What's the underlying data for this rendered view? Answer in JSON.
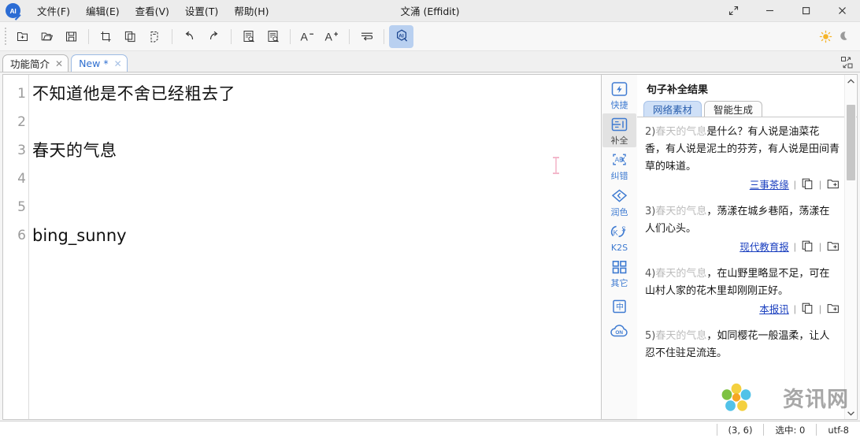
{
  "window": {
    "title": "文涌 (Effidit)",
    "logo_text": "AI",
    "controls": {
      "fullscreen": "fullscreen-icon",
      "minimize": "minimize-icon",
      "maximize": "maximize-icon",
      "close": "close-icon"
    }
  },
  "menubar": {
    "items": [
      {
        "label": "文件(F)",
        "name": "menu-file"
      },
      {
        "label": "编辑(E)",
        "name": "menu-edit"
      },
      {
        "label": "查看(V)",
        "name": "menu-view"
      },
      {
        "label": "设置(T)",
        "name": "menu-settings"
      },
      {
        "label": "帮助(H)",
        "name": "menu-help"
      }
    ]
  },
  "toolbar": {
    "buttons": [
      {
        "icon": "new-file-icon",
        "name": "new-file-button"
      },
      {
        "icon": "open-folder-icon",
        "name": "open-file-button"
      },
      {
        "icon": "save-icon",
        "name": "save-button"
      },
      {
        "icon": "cut-icon",
        "name": "cut-button"
      },
      {
        "icon": "copy-icon",
        "name": "copy-button"
      },
      {
        "icon": "paste-icon",
        "name": "paste-button"
      },
      {
        "icon": "undo-icon",
        "name": "undo-button"
      },
      {
        "icon": "redo-icon",
        "name": "redo-button"
      },
      {
        "icon": "find-icon",
        "name": "find-button"
      },
      {
        "icon": "replace-icon",
        "name": "replace-button"
      },
      {
        "icon": "font-decrease-icon",
        "name": "font-decrease-button"
      },
      {
        "icon": "font-increase-icon",
        "name": "font-increase-button"
      },
      {
        "icon": "wrap-text-icon",
        "name": "wrap-text-button"
      },
      {
        "icon": "ai-assistant-icon",
        "name": "ai-assistant-button"
      }
    ],
    "theme": {
      "light_icon": "sun-icon",
      "dark_icon": "moon-icon"
    }
  },
  "tabs": {
    "items": [
      {
        "label": "功能简介",
        "active": false,
        "closable": true
      },
      {
        "label": "New *",
        "active": true,
        "closable": true
      }
    ],
    "split_view_icon": "split-layout-icon"
  },
  "editor": {
    "lines": [
      {
        "no": "1",
        "text": "不知道他是不舍已经粗去了",
        "script": "cjk"
      },
      {
        "no": "2",
        "text": "",
        "script": "cjk"
      },
      {
        "no": "3",
        "text": "春天的气息",
        "script": "cjk"
      },
      {
        "no": "4",
        "text": "",
        "script": "cjk"
      },
      {
        "no": "5",
        "text": "",
        "script": "cjk"
      },
      {
        "no": "6",
        "text": "bing_sunny",
        "script": "latin"
      }
    ]
  },
  "rail": {
    "items": [
      {
        "label": "快捷",
        "icon": "lightning-icon",
        "active": false,
        "name": "rail-item-shortcut"
      },
      {
        "label": "补全",
        "icon": "completion-icon",
        "active": true,
        "name": "rail-item-completion"
      },
      {
        "label": "纠错",
        "icon": "spellcheck-icon",
        "active": false,
        "name": "rail-item-proofread"
      },
      {
        "label": "润色",
        "icon": "polish-diamond-icon",
        "active": false,
        "name": "rail-item-polish"
      },
      {
        "label": "K2S",
        "icon": "keywords-to-sentence-icon",
        "active": false,
        "name": "rail-item-k2s"
      },
      {
        "label": "其它",
        "icon": "grid-icon",
        "active": false,
        "name": "rail-item-other"
      }
    ],
    "footer": [
      {
        "label": "中",
        "icon": "language-chinese-icon",
        "name": "rail-language-toggle"
      },
      {
        "label": "ON",
        "icon": "cloud-on-icon",
        "name": "rail-cloud-toggle"
      }
    ]
  },
  "panel": {
    "title": "句子补全结果",
    "tabs": [
      {
        "label": "网络素材",
        "active": true
      },
      {
        "label": "智能生成",
        "active": false
      }
    ],
    "suggestions": [
      {
        "index": "2)",
        "prefix": "春天的气息",
        "body": "是什么？有人说是油菜花香，有人说是泥土的芬芳，有人说是田间青草的味道。",
        "source": "三事茶缘",
        "copy_icon": "copy-icon",
        "add_icon": "add-to-folder-icon"
      },
      {
        "index": "3)",
        "prefix": "春天的气息",
        "body": "，荡漾在城乡巷陌，荡漾在人们心头。",
        "source": "现代教育报",
        "copy_icon": "copy-icon",
        "add_icon": "add-to-folder-icon"
      },
      {
        "index": "4)",
        "prefix": "春天的气息",
        "body": "，在山野里略显不足，可在山村人家的花木里却刚刚正好。",
        "source": "本报讯",
        "copy_icon": "copy-icon",
        "add_icon": "add-to-folder-icon"
      },
      {
        "index": "5)",
        "prefix": "春天的气息",
        "body": "，如同樱花一般温柔，让人忍不住驻足流连。",
        "source": "",
        "copy_icon": "copy-icon",
        "add_icon": "add-to-folder-icon"
      }
    ],
    "scrollbar": {
      "up_icon": "chevron-up-icon",
      "down_icon": "chevron-down-icon"
    }
  },
  "watermark": {
    "text": "资讯网",
    "logo": "flower-logo-icon"
  },
  "statusbar": {
    "position": "(3, 6)",
    "selection": "选中: 0",
    "encoding": "utf-8"
  },
  "colors": {
    "accent": "#2f6fd0",
    "link": "#1a3fbf",
    "rail_icon": "#3f7bd1",
    "tab_active_bg": "#cfe0f7"
  }
}
